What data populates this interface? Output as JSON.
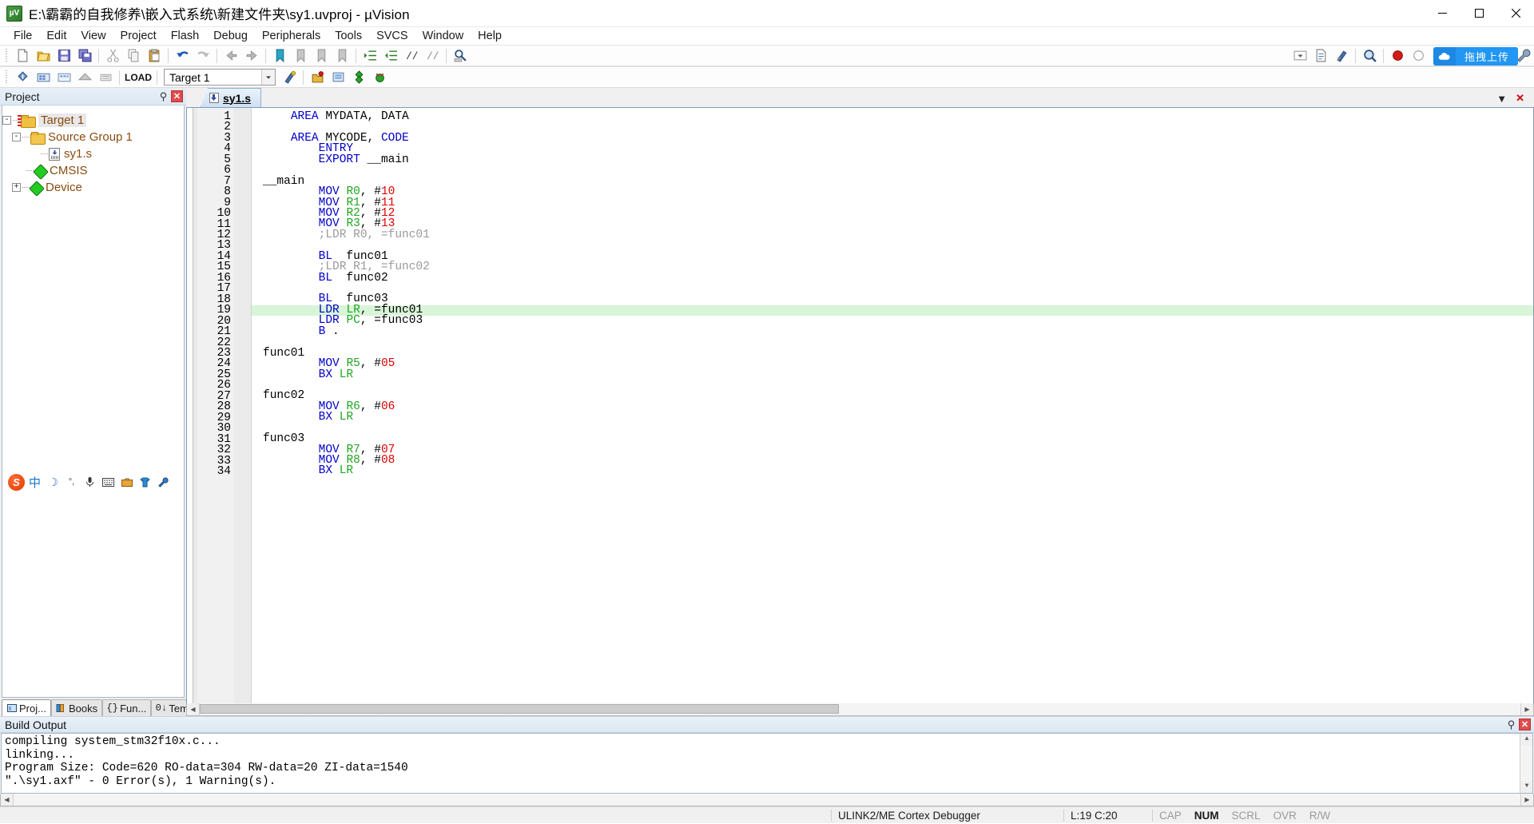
{
  "window": {
    "title": "E:\\霸霸的自我修养\\嵌入式系统\\新建文件夹\\sy1.uvproj - µVision",
    "app_icon": "uvision-icon",
    "minimize": "minimize-icon",
    "maximize": "maximize-icon",
    "close": "close-icon"
  },
  "menu": {
    "items": [
      "File",
      "Edit",
      "View",
      "Project",
      "Flash",
      "Debug",
      "Peripherals",
      "Tools",
      "SVCS",
      "Window",
      "Help"
    ]
  },
  "toolbar_main": {
    "buttons": [
      "new-file-icon",
      "open-file-icon",
      "save-icon",
      "save-all-icon",
      "cut-icon",
      "copy-icon",
      "paste-icon",
      "undo-icon",
      "redo-icon",
      "navigate-back-icon",
      "navigate-forward-icon",
      "bookmark-toggle-icon",
      "bookmark-prev-icon",
      "bookmark-next-icon",
      "bookmark-clear-icon",
      "indent-icon",
      "outdent-icon",
      "comment-icon",
      "uncomment-icon",
      "find-in-files-icon",
      "dropdown-icon",
      "insert-file-icon",
      "configure-icon",
      "find-icon",
      "insert-breakpoint-icon",
      "disable-breakpoint-icon",
      "kill-breakpoints-icon",
      "disable-all-breakpoints-icon",
      "window-layout-icon",
      "layout-dropdown-icon",
      "configure-target-icon"
    ]
  },
  "toolbar_build": {
    "buttons": [
      "translate-icon",
      "build-icon",
      "rebuild-icon",
      "batch-build-icon",
      "stop-build-icon",
      "download-icon",
      "target-selector",
      "target-options-icon",
      "manage-project-items-icon",
      "pack-installer-icon",
      "run-debug-icon",
      "debug-session-icon"
    ],
    "load_label": "LOAD",
    "target_value": "Target 1",
    "target_dropdown": "chevron-down-icon"
  },
  "upload_widget": {
    "icon": "cloud-upload-icon",
    "label": "拖拽上传"
  },
  "project_panel": {
    "caption": "Project",
    "pin": "pin-icon",
    "close": "close-icon",
    "tree": [
      {
        "label": "Target 1",
        "icon": "target-folder-icon",
        "expander": "-",
        "level": 0,
        "selected": true
      },
      {
        "label": "Source Group 1",
        "icon": "folder-icon",
        "expander": "-",
        "level": 1,
        "selected": false
      },
      {
        "label": "sy1.s",
        "icon": "asm-file-icon",
        "expander": "",
        "level": 2,
        "selected": false
      },
      {
        "label": "CMSIS",
        "icon": "component-icon",
        "expander": "",
        "level": 1,
        "selected": false
      },
      {
        "label": "Device",
        "icon": "component-icon",
        "expander": "+",
        "level": 1,
        "selected": false
      }
    ],
    "tabs": [
      {
        "label": "Proj...",
        "icon": "project-icon",
        "active": true
      },
      {
        "label": "Books",
        "icon": "books-icon",
        "active": false
      },
      {
        "label": "Fun...",
        "icon": "functions-icon",
        "active": false
      },
      {
        "label": "Tem...",
        "icon": "templates-icon",
        "active": false
      }
    ]
  },
  "ime_bar": {
    "items": [
      "sogou-logo-icon",
      "chinese-mode-icon",
      "moon-icon",
      "degree-icon",
      "microphone-icon",
      "keyboard-icon",
      "toolbox-icon",
      "skin-icon",
      "settings-icon"
    ],
    "chinese_label": "中"
  },
  "editor": {
    "tabs": [
      {
        "label": "sy1.s",
        "icon": "asm-file-icon",
        "active": true
      }
    ],
    "tab_controls": {
      "minimize": "chevron-down-icon",
      "close": "close-icon"
    },
    "total_lines": 34,
    "highlighted_line": 19,
    "lines": [
      {
        "n": 1,
        "tokens": [
          {
            "t": "    ",
            "c": "plain"
          },
          {
            "t": "AREA",
            "c": "kw"
          },
          {
            "t": " MYDATA, DATA",
            "c": "plain"
          }
        ]
      },
      {
        "n": 2,
        "tokens": []
      },
      {
        "n": 3,
        "tokens": [
          {
            "t": "    ",
            "c": "plain"
          },
          {
            "t": "AREA",
            "c": "kw"
          },
          {
            "t": " MYCODE, ",
            "c": "plain"
          },
          {
            "t": "CODE",
            "c": "kw"
          }
        ]
      },
      {
        "n": 4,
        "tokens": [
          {
            "t": "        ",
            "c": "plain"
          },
          {
            "t": "ENTRY",
            "c": "kw"
          }
        ]
      },
      {
        "n": 5,
        "tokens": [
          {
            "t": "        ",
            "c": "plain"
          },
          {
            "t": "EXPORT",
            "c": "kw"
          },
          {
            "t": " __main",
            "c": "plain"
          }
        ]
      },
      {
        "n": 6,
        "tokens": []
      },
      {
        "n": 7,
        "tokens": [
          {
            "t": "__main",
            "c": "plain"
          }
        ]
      },
      {
        "n": 8,
        "tokens": [
          {
            "t": "        ",
            "c": "plain"
          },
          {
            "t": "MOV",
            "c": "kw"
          },
          {
            "t": " ",
            "c": "plain"
          },
          {
            "t": "R0",
            "c": "reg"
          },
          {
            "t": ", #",
            "c": "plain"
          },
          {
            "t": "10",
            "c": "num"
          }
        ]
      },
      {
        "n": 9,
        "tokens": [
          {
            "t": "        ",
            "c": "plain"
          },
          {
            "t": "MOV",
            "c": "kw"
          },
          {
            "t": " ",
            "c": "plain"
          },
          {
            "t": "R1",
            "c": "reg"
          },
          {
            "t": ", #",
            "c": "plain"
          },
          {
            "t": "11",
            "c": "num"
          }
        ]
      },
      {
        "n": 10,
        "tokens": [
          {
            "t": "        ",
            "c": "plain"
          },
          {
            "t": "MOV",
            "c": "kw"
          },
          {
            "t": " ",
            "c": "plain"
          },
          {
            "t": "R2",
            "c": "reg"
          },
          {
            "t": ", #",
            "c": "plain"
          },
          {
            "t": "12",
            "c": "num"
          }
        ]
      },
      {
        "n": 11,
        "tokens": [
          {
            "t": "        ",
            "c": "plain"
          },
          {
            "t": "MOV",
            "c": "kw"
          },
          {
            "t": " ",
            "c": "plain"
          },
          {
            "t": "R3",
            "c": "reg"
          },
          {
            "t": ", #",
            "c": "plain"
          },
          {
            "t": "13",
            "c": "num"
          }
        ]
      },
      {
        "n": 12,
        "tokens": [
          {
            "t": "        ;LDR R0, =func01",
            "c": "cmt"
          }
        ]
      },
      {
        "n": 13,
        "tokens": []
      },
      {
        "n": 14,
        "tokens": [
          {
            "t": "        ",
            "c": "plain"
          },
          {
            "t": "BL",
            "c": "kw"
          },
          {
            "t": "  func01",
            "c": "plain"
          }
        ]
      },
      {
        "n": 15,
        "tokens": [
          {
            "t": "        ;LDR R1, =func02",
            "c": "cmt"
          }
        ]
      },
      {
        "n": 16,
        "tokens": [
          {
            "t": "        ",
            "c": "plain"
          },
          {
            "t": "BL",
            "c": "kw"
          },
          {
            "t": "  func02",
            "c": "plain"
          }
        ]
      },
      {
        "n": 17,
        "tokens": []
      },
      {
        "n": 18,
        "tokens": [
          {
            "t": "        ",
            "c": "plain"
          },
          {
            "t": "BL",
            "c": "kw"
          },
          {
            "t": "  func03",
            "c": "plain"
          }
        ]
      },
      {
        "n": 19,
        "tokens": [
          {
            "t": "        ",
            "c": "plain"
          },
          {
            "t": "LDR",
            "c": "kw"
          },
          {
            "t": " ",
            "c": "plain"
          },
          {
            "t": "LR",
            "c": "reg"
          },
          {
            "t": ", =func01",
            "c": "plain"
          }
        ],
        "highlight": true
      },
      {
        "n": 20,
        "tokens": [
          {
            "t": "        ",
            "c": "plain"
          },
          {
            "t": "LDR",
            "c": "kw"
          },
          {
            "t": " ",
            "c": "plain"
          },
          {
            "t": "PC",
            "c": "reg"
          },
          {
            "t": ", =func03",
            "c": "plain"
          }
        ]
      },
      {
        "n": 21,
        "tokens": [
          {
            "t": "        ",
            "c": "plain"
          },
          {
            "t": "B",
            "c": "kw"
          },
          {
            "t": " .",
            "c": "plain"
          }
        ]
      },
      {
        "n": 22,
        "tokens": []
      },
      {
        "n": 23,
        "tokens": [
          {
            "t": "func01",
            "c": "plain"
          }
        ]
      },
      {
        "n": 24,
        "tokens": [
          {
            "t": "        ",
            "c": "plain"
          },
          {
            "t": "MOV",
            "c": "kw"
          },
          {
            "t": " ",
            "c": "plain"
          },
          {
            "t": "R5",
            "c": "reg"
          },
          {
            "t": ", #",
            "c": "plain"
          },
          {
            "t": "05",
            "c": "num"
          }
        ]
      },
      {
        "n": 25,
        "tokens": [
          {
            "t": "        ",
            "c": "plain"
          },
          {
            "t": "BX",
            "c": "kw"
          },
          {
            "t": " ",
            "c": "plain"
          },
          {
            "t": "LR",
            "c": "reg"
          }
        ]
      },
      {
        "n": 26,
        "tokens": []
      },
      {
        "n": 27,
        "tokens": [
          {
            "t": "func02",
            "c": "plain"
          }
        ]
      },
      {
        "n": 28,
        "tokens": [
          {
            "t": "        ",
            "c": "plain"
          },
          {
            "t": "MOV",
            "c": "kw"
          },
          {
            "t": " ",
            "c": "plain"
          },
          {
            "t": "R6",
            "c": "reg"
          },
          {
            "t": ", #",
            "c": "plain"
          },
          {
            "t": "06",
            "c": "num"
          }
        ]
      },
      {
        "n": 29,
        "tokens": [
          {
            "t": "        ",
            "c": "plain"
          },
          {
            "t": "BX",
            "c": "kw"
          },
          {
            "t": " ",
            "c": "plain"
          },
          {
            "t": "LR",
            "c": "reg"
          }
        ]
      },
      {
        "n": 30,
        "tokens": []
      },
      {
        "n": 31,
        "tokens": [
          {
            "t": "func03",
            "c": "plain"
          }
        ]
      },
      {
        "n": 32,
        "tokens": [
          {
            "t": "        ",
            "c": "plain"
          },
          {
            "t": "MOV",
            "c": "kw"
          },
          {
            "t": " ",
            "c": "plain"
          },
          {
            "t": "R7",
            "c": "reg"
          },
          {
            "t": ", #",
            "c": "plain"
          },
          {
            "t": "07",
            "c": "num"
          }
        ]
      },
      {
        "n": 33,
        "tokens": [
          {
            "t": "        ",
            "c": "plain"
          },
          {
            "t": "MOV",
            "c": "kw"
          },
          {
            "t": " ",
            "c": "plain"
          },
          {
            "t": "R8",
            "c": "reg"
          },
          {
            "t": ", #",
            "c": "plain"
          },
          {
            "t": "08",
            "c": "num"
          }
        ]
      },
      {
        "n": 34,
        "tokens": [
          {
            "t": "        ",
            "c": "plain"
          },
          {
            "t": "BX",
            "c": "kw"
          },
          {
            "t": " ",
            "c": "plain"
          },
          {
            "t": "LR",
            "c": "reg"
          }
        ]
      }
    ]
  },
  "build_output": {
    "caption": "Build Output",
    "pin": "pin-icon",
    "close": "close-icon",
    "lines": [
      "compiling system_stm32f10x.c...",
      "linking...",
      "Program Size: Code=620 RO-data=304 RW-data=20 ZI-data=1540",
      "\".\\sy1.axf\" - 0 Error(s), 1 Warning(s)."
    ]
  },
  "statusbar": {
    "debugger": "ULINK2/ME Cortex Debugger",
    "cursor": "L:19 C:20",
    "indicators": [
      {
        "label": "CAP",
        "active": false
      },
      {
        "label": "NUM",
        "active": true
      },
      {
        "label": "SCRL",
        "active": false
      },
      {
        "label": "OVR",
        "active": false
      },
      {
        "label": "R/W",
        "active": false
      }
    ]
  },
  "colors": {
    "keyword": "#0000c8",
    "register": "#22a522",
    "number": "#e00000",
    "comment": "#9a9a9a",
    "highlight_line": "#d8f5d8",
    "tree_text": "#8a4b10",
    "accent_blue": "#2196f3"
  }
}
